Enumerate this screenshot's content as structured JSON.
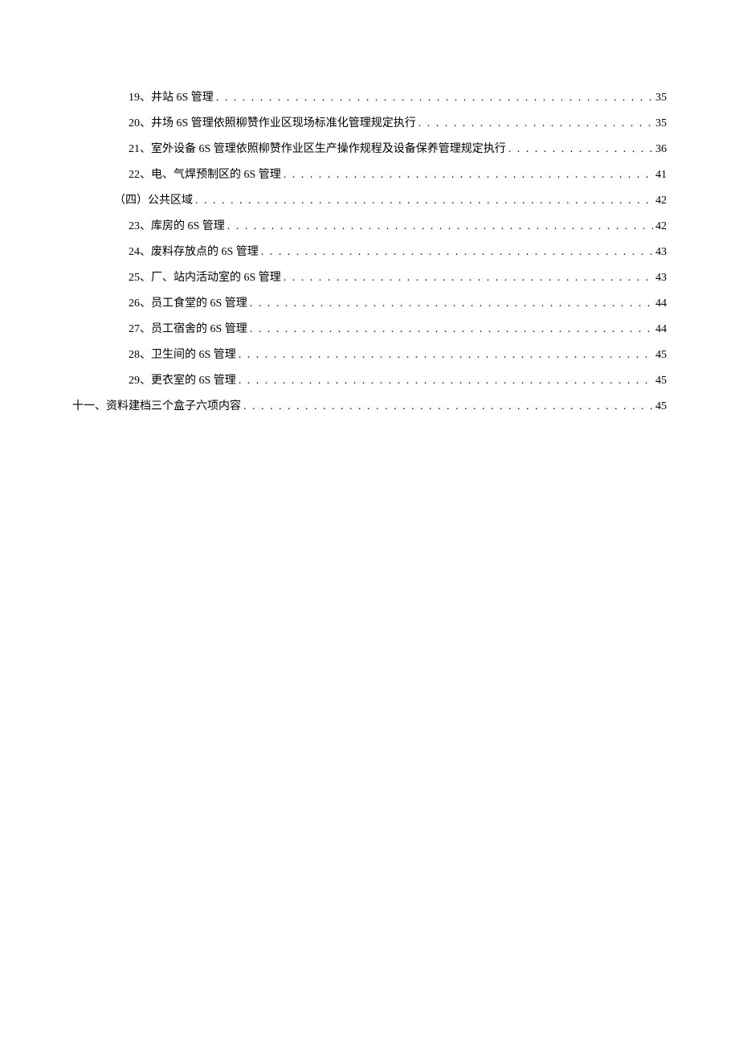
{
  "toc": [
    {
      "level": "level-2",
      "title": "19、井站 6S 管理",
      "page": "35"
    },
    {
      "level": "level-2",
      "title": "20、井场 6S 管理依照柳赞作业区现场标准化管理规定执行",
      "page": "35"
    },
    {
      "level": "level-2",
      "title": "21、室外设备 6S 管理依照柳赞作业区生产操作规程及设备保养管理规定执行",
      "page": "36"
    },
    {
      "level": "level-2",
      "title": "22、电、气焊预制区的 6S 管理",
      "page": "41"
    },
    {
      "level": "level-3",
      "title": "（四）公共区域",
      "page": "42"
    },
    {
      "level": "level-2",
      "title": "23、库房的 6S 管理",
      "page": "42"
    },
    {
      "level": "level-2",
      "title": "24、废料存放点的 6S 管理",
      "page": "43"
    },
    {
      "level": "level-2",
      "title": "25、厂、站内活动室的 6S 管理",
      "page": "43"
    },
    {
      "level": "level-2",
      "title": "26、员工食堂的 6S 管理",
      "page": "44"
    },
    {
      "level": "level-2",
      "title": "27、员工宿舍的 6S 管理",
      "page": "44"
    },
    {
      "level": "level-2",
      "title": "28、卫生间的 6S 管理",
      "page": "45"
    },
    {
      "level": "level-2",
      "title": "29、更衣室的 6S 管理",
      "page": "45"
    },
    {
      "level": "level-0",
      "title": "十一、资料建档三个盒子六项内容",
      "page": "45"
    }
  ]
}
